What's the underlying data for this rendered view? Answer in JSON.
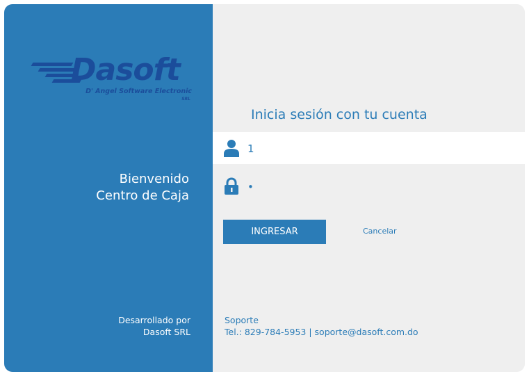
{
  "brand": {
    "name": "Dasoft",
    "tagline": "D' Angel Software Electronic",
    "suffix": "SRL",
    "color": "#1b4d9b"
  },
  "left_panel": {
    "welcome_line1": "Bienvenido",
    "welcome_line2": "Centro de Caja",
    "developed_by_line1": "Desarrollado por",
    "developed_by_line2": "Dasoft SRL",
    "background_color": "#2b7cb7"
  },
  "login": {
    "title": "Inicia sesión con tu cuenta",
    "user_field": {
      "value": "1",
      "icon": "user-icon"
    },
    "password_field": {
      "value": "•",
      "icon": "lock-icon"
    },
    "submit_label": "INGRESAR",
    "cancel_label": "Cancelar"
  },
  "support": {
    "heading": "Soporte",
    "contact": "Tel.: 829-784-5953 | soporte@dasoft.com.do"
  },
  "colors": {
    "accent": "#2b7cb7",
    "panel_bg": "#efefef"
  }
}
